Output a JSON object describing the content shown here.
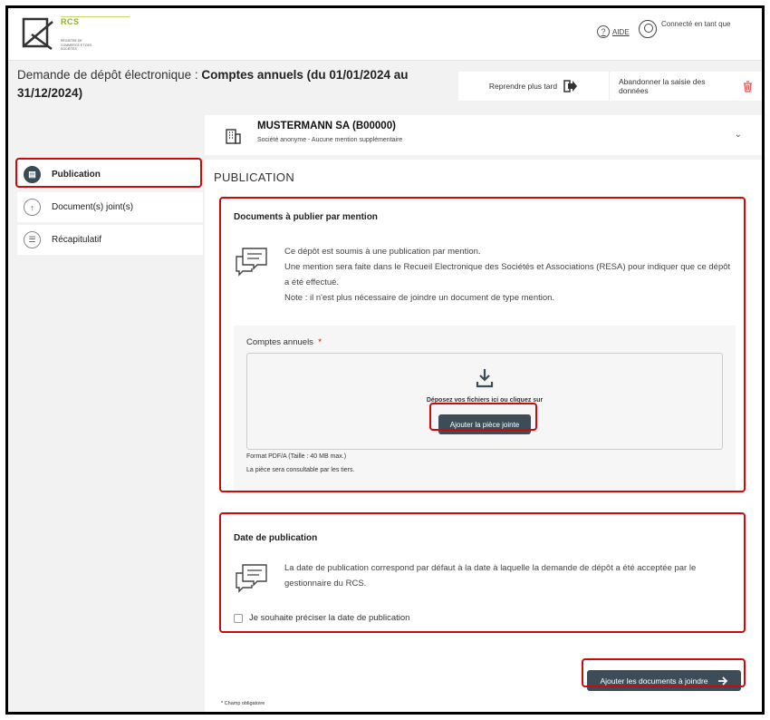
{
  "header": {
    "logo_title": "RCS",
    "logo_subtitle": "REGISTRE DE COMMERCE ET DES SOCIÉTÉS",
    "help_label": "AIDE",
    "user_label": "Connecté en tant que"
  },
  "page": {
    "title_prefix": "Demande de dépôt électronique : ",
    "title_bold": "Comptes annuels (du 01/01/2024 au 31/12/2024)"
  },
  "actions": {
    "save_later": "Reprendre plus tard",
    "abandon": "Abandonner la saisie des données"
  },
  "company": {
    "name": "MUSTERMANN SA (B00000)",
    "subtitle": "Société anonyme - Aucune mention supplémentaire"
  },
  "sidebar": {
    "items": [
      {
        "label": "Publication"
      },
      {
        "label": "Document(s) joint(s)"
      },
      {
        "label": "Récapitulatif"
      }
    ]
  },
  "main": {
    "section_title": "PUBLICATION",
    "mention_card": {
      "title": "Documents à publier par mention",
      "line1": "Ce dépôt est soumis à une publication par mention.",
      "line2": "Une mention sera faite dans le Recueil Electronique des Sociétés et Associations (RESA) pour indiquer que ce dépôt a été effectué.",
      "line3": "Note : il n'est plus nécessaire de joindre un document de type mention.",
      "upload_label": "Comptes annuels",
      "required_mark": "*",
      "drop_text": "Déposez vos fichiers ici ou cliquez sur",
      "attach_button": "Ajouter la pièce jointe",
      "format_text": "Format PDF/A (Taille : 40 MB max.)",
      "visibility_text": "La pièce sera consultable par les tiers."
    },
    "date_card": {
      "title": "Date de publication",
      "text": "La date de publication correspond par défaut à la date à laquelle la demande de dépôt a été acceptée par le gestionnaire du RCS.",
      "checkbox_label": "Je souhaite préciser la date de publication",
      "checkbox_checked": false
    },
    "next_button": "Ajouter les documents à joindre",
    "mandatory_note": "* Champ obligatoire"
  },
  "colors": {
    "highlight": "#cc0a0a",
    "dark_button": "#3d4d58",
    "logo_green": "#8bb51e"
  }
}
